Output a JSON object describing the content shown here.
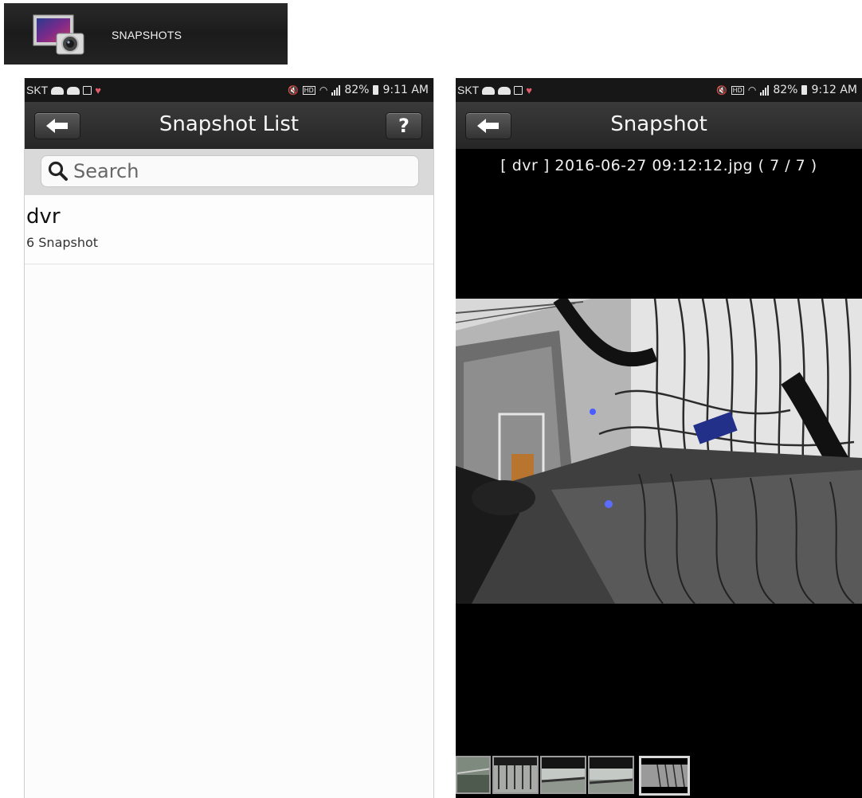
{
  "banner": {
    "title": "SNAPSHOTS",
    "icon": "photo-camera-icon"
  },
  "left_phone": {
    "status": {
      "carrier": "SKT",
      "battery": "82%",
      "time": "9:11 AM"
    },
    "appbar": {
      "title": "Snapshot List",
      "help_label": "?"
    },
    "search": {
      "placeholder": "Search"
    },
    "items": [
      {
        "title": "dvr",
        "subtitle": "6 Snapshot"
      }
    ]
  },
  "right_phone": {
    "status": {
      "carrier": "SKT",
      "battery": "82%",
      "time": "9:12 AM"
    },
    "appbar": {
      "title": "Snapshot"
    },
    "caption": "[ dvr ] 2016-06-27 09:12:12.jpg ( 7 / 7 )",
    "thumbnails": 5,
    "selected_thumbnail": 5
  }
}
